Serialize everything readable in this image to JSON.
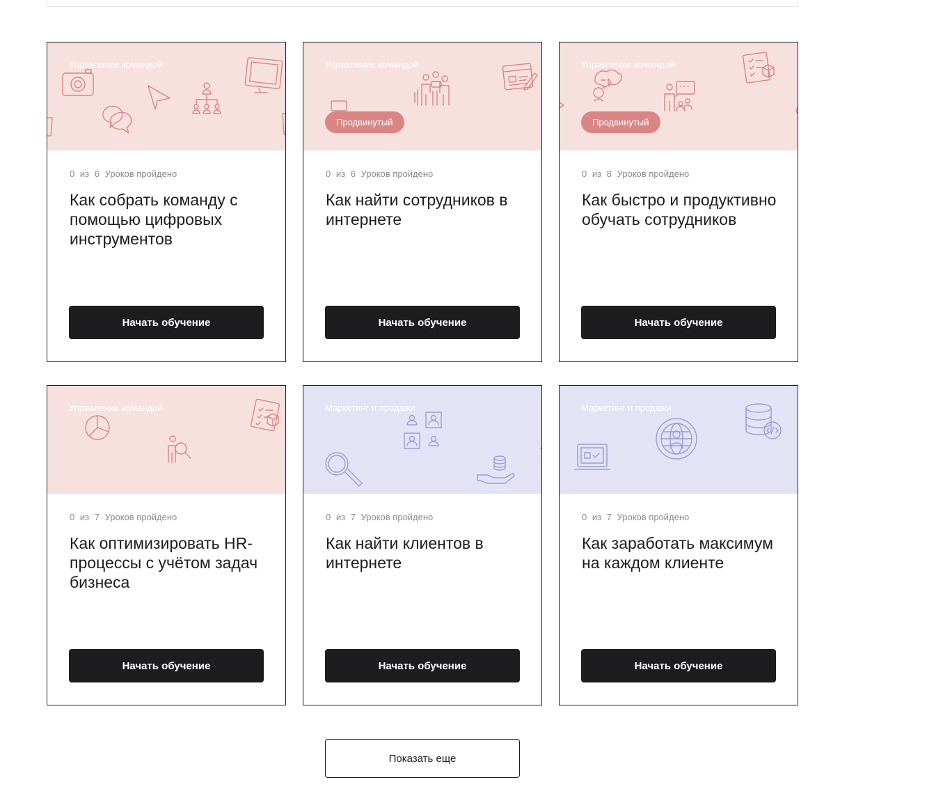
{
  "colors": {
    "cover_pink": "#f7e1df",
    "cover_violet": "#e3e3f5",
    "icon_pink": "#d98585",
    "icon_violet": "#9c9bd6",
    "badge": "#d98585",
    "button": "#1d1d1f"
  },
  "courses": [
    {
      "category": "Управление командой",
      "theme": "pink",
      "level": "",
      "progress": {
        "done": "0",
        "of": "из",
        "total": "6",
        "label": "Уроков пройдено"
      },
      "title": "Как собрать команду с помощью цифровых инструментов",
      "button": "Начать обучение",
      "icons": [
        "camera-icon",
        "chat-bubbles-icon",
        "paper-plane-icon",
        "org-chart-icon",
        "monitor-icon"
      ]
    },
    {
      "category": "Управление командой",
      "theme": "pink",
      "level": "Продвинутый",
      "progress": {
        "done": "0",
        "of": "из",
        "total": "6",
        "label": "Уроков пройдено"
      },
      "title": "Как найти сотрудников в интернете",
      "button": "Начать обучение",
      "icons": [
        "people-group-icon",
        "browser-edit-icon"
      ]
    },
    {
      "category": "Управление командой",
      "theme": "pink",
      "level": "Продвинутый",
      "progress": {
        "done": "0",
        "of": "из",
        "total": "8",
        "label": "Уроков пройдено"
      },
      "title": "Как быстро и продуктивно обучать сотрудников",
      "button": "Начать обучение",
      "icons": [
        "thinking-head-icon",
        "presenter-icon",
        "checklist-box-icon"
      ]
    },
    {
      "category": "Управление командой",
      "theme": "pink",
      "level": "",
      "progress": {
        "done": "0",
        "of": "из",
        "total": "7",
        "label": "Уроков пройдено"
      },
      "title": "Как оптимизировать HR-процессы с учётом задач бизнеса",
      "button": "Начать обучение",
      "icons": [
        "pie-chart-icon",
        "person-search-icon",
        "checklist-box-icon"
      ]
    },
    {
      "category": "Маркетинг и продажи",
      "theme": "violet",
      "level": "",
      "progress": {
        "done": "0",
        "of": "из",
        "total": "7",
        "label": "Уроков пройдено"
      },
      "title": "Как найти клиентов в интернете",
      "button": "Начать обучение",
      "icons": [
        "profiles-grid-icon",
        "magnifier-icon",
        "coins-hand-icon"
      ]
    },
    {
      "category": "Маркетинг и продажи",
      "theme": "violet",
      "level": "",
      "progress": {
        "done": "0",
        "of": "из",
        "total": "7",
        "label": "Уроков пройдено"
      },
      "title": "Как заработать максимум на каждом клиенте",
      "button": "Начать обучение",
      "icons": [
        "laptop-checklist-icon",
        "globe-person-icon",
        "database-code-icon"
      ]
    }
  ],
  "show_more": "Показать еще"
}
